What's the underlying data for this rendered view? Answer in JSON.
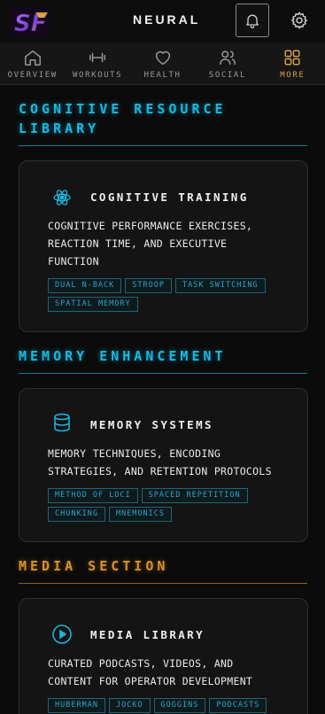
{
  "header": {
    "logo_text": "SF",
    "title": "NEURAL"
  },
  "nav": [
    {
      "label": "OVERVIEW",
      "icon": "home-icon",
      "active": false
    },
    {
      "label": "WORKOUTS",
      "icon": "dumbbell-icon",
      "active": false
    },
    {
      "label": "HEALTH",
      "icon": "heart-icon",
      "active": false
    },
    {
      "label": "SOCIAL",
      "icon": "users-icon",
      "active": false
    },
    {
      "label": "MORE",
      "icon": "grid-icon",
      "active": true
    }
  ],
  "colors": {
    "cyan": "#1ab8e0",
    "orange": "#d9912a",
    "active_nav": "#d4a04a",
    "background": "#0b0b0b"
  },
  "sections": [
    {
      "title_line1": "COGNITIVE RESOURCE",
      "title_line2": "LIBRARY",
      "card": {
        "icon": "atom-icon",
        "title": "COGNITIVE TRAINING",
        "desc_lines": [
          "COGNITIVE PERFORMANCE EXERCISES,",
          "REACTION TIME, AND EXECUTIVE",
          "FUNCTION"
        ],
        "tags": [
          "DUAL N-BACK",
          "STROOP",
          "TASK SWITCHING",
          "SPATIAL MEMORY"
        ]
      }
    },
    {
      "title_line1": "MEMORY ENHANCEMENT",
      "card": {
        "icon": "database-icon",
        "title": "MEMORY SYSTEMS",
        "desc_lines": [
          "MEMORY TECHNIQUES, ENCODING",
          "STRATEGIES, AND RETENTION PROTOCOLS"
        ],
        "tags": [
          "METHOD OF LOCI",
          "SPACED REPETITION",
          "CHUNKING",
          "MNEMONICS"
        ]
      }
    },
    {
      "title_line1": "MEDIA SECTION",
      "card": {
        "icon": "play-icon",
        "title": "MEDIA LIBRARY",
        "desc_lines": [
          "CURATED PODCASTS, VIDEOS, AND",
          "CONTENT FOR OPERATOR DEVELOPMENT"
        ],
        "tags": [
          "HUBERMAN",
          "JOCKO",
          "GOGGINS",
          "PODCASTS"
        ]
      }
    }
  ]
}
